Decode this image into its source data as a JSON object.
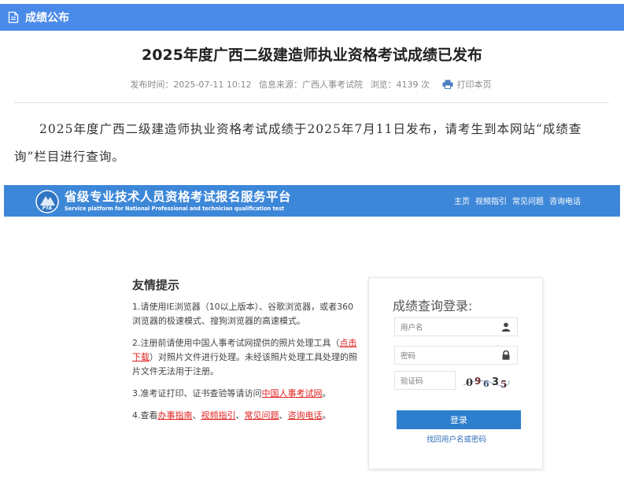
{
  "header": {
    "title": "成绩公布",
    "icon": "document-icon"
  },
  "article": {
    "title": "2025年度广西二级建造师执业资格考试成绩已发布",
    "meta": {
      "publish_time": "发布时间：2025-07-11 10:12",
      "source": "信息来源：广西人事考试院",
      "views": "浏览：4139 次",
      "print_label": "打印本页"
    },
    "body": "2025年度广西二级建造师执业资格考试成绩于2025年7月11日发布，请考生到本网站“成绩查询”栏目进行查询。"
  },
  "platform": {
    "title": "省级专业技术人员资格考试报名服务平台",
    "subtitle": "Service platform for National Professional and technician qualification test",
    "logo_text": "PTA",
    "nav": [
      "主页",
      "视频指引",
      "常见问题",
      "咨询电话"
    ]
  },
  "tips": {
    "title": "友情提示",
    "tip1": "1.请使用IE浏览器（10以上版本）、谷歌浏览器，或者360浏览器的极速模式、搜狗浏览器的高速模式。",
    "tip2_before": "2.注册前请使用中国人事考试网提供的照片处理工具（",
    "tip2_link": "点击下载",
    "tip2_after": "）对照片文件进行处理。未经该照片处理工具处理的照片文件无法用于注册。",
    "tip3_before": "3.准考证打印、证书查验等请访问",
    "tip3_link": "中国人事考试网",
    "tip3_after": "。",
    "tip4_before": "4.查看",
    "tip4_links": [
      "办事指南",
      "视频指引",
      "常见问题",
      "咨询电话"
    ],
    "tip4_sep": "、",
    "tip4_after": "。"
  },
  "login": {
    "title": "成绩查询登录:",
    "username_placeholder": "用户名",
    "password_placeholder": "密码",
    "captcha_placeholder": "验证码",
    "captcha_code": "09635",
    "login_button": "登录",
    "forgot_link": "找回用户名或密码"
  },
  "colors": {
    "header_bar": "#4a8ae8",
    "banner": "#3d87d8",
    "login_button": "#2d7fce",
    "link_red": "#e02020"
  }
}
